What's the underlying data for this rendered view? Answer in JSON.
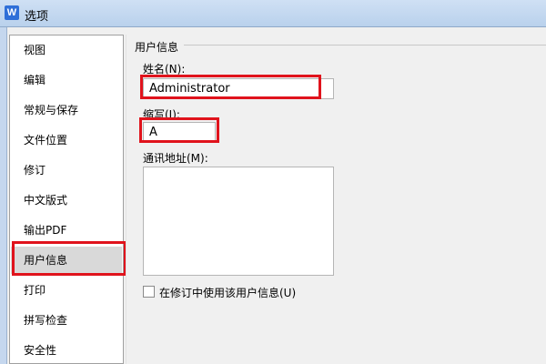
{
  "window": {
    "title": "选项",
    "app_icon": "wps-writer-icon",
    "accent": "#2f6fd8"
  },
  "sidebar": {
    "items": [
      {
        "label": "视图",
        "selected": false
      },
      {
        "label": "编辑",
        "selected": false
      },
      {
        "label": "常规与保存",
        "selected": false
      },
      {
        "label": "文件位置",
        "selected": false
      },
      {
        "label": "修订",
        "selected": false
      },
      {
        "label": "中文版式",
        "selected": false
      },
      {
        "label": "输出PDF",
        "selected": false
      },
      {
        "label": "用户信息",
        "selected": true
      },
      {
        "label": "打印",
        "selected": false
      },
      {
        "label": "拼写检查",
        "selected": false
      },
      {
        "label": "安全性",
        "selected": false
      }
    ],
    "selected_bg": "#d9d9d9"
  },
  "user_info": {
    "group_title": "用户信息",
    "name_label": "姓名(N):",
    "name_value": "Administrator",
    "initials_label": "缩写(I):",
    "initials_value": "A",
    "address_label": "通讯地址(M):",
    "address_value": "",
    "use_in_revisions_label": "在修订中使用该用户信息(U)",
    "use_in_revisions_checked": false
  },
  "annotation_color": "#e0131c"
}
